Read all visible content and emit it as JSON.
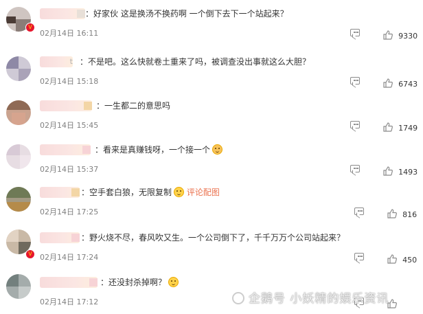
{
  "comments": [
    {
      "text": "：好家伙 这是换汤不换药啊 一个倒下去下一个站起来？",
      "time": "02月14日 16:11",
      "likes": "9330",
      "verified": true,
      "name_tail": "g"
    },
    {
      "text": "：不是吧。这么快就卷土重来了吗，被调查没出事就这么大胆？",
      "time": "02月14日 15:18",
      "likes": "6743",
      "verified": false,
      "name_tail": "t"
    },
    {
      "text": "：一生都二的意思吗",
      "time": "02月14日 15:45",
      "likes": "1749",
      "verified": false,
      "name_tail": "y"
    },
    {
      "text": "：看来是真赚钱呀，一个接一个",
      "time": "02月14日 15:37",
      "likes": "1493",
      "verified": false,
      "name_tail": "p"
    },
    {
      "text": "：空手套白狼，无限复制",
      "link": "评论配图",
      "time": "02月14日 17:25",
      "likes": "816",
      "verified": false,
      "name_tail": "y"
    },
    {
      "text": "：野火烧不尽，春风吹又生。一个公司倒下了，千千万万个公司站起来？",
      "time": "02月14日 17:24",
      "likes": "450",
      "verified": true,
      "name_tail": "p"
    },
    {
      "text": "：还没封杀掉啊？",
      "time": "02月14日 17:12",
      "likes": "",
      "verified": false,
      "name_tail": "p"
    }
  ],
  "watermark": "企鹅号 小妖精的娱乐资讯",
  "colors": {
    "link": "#eb7350",
    "time": "#808080",
    "icon": "#8a8a8a",
    "verified_badge": "#e6162d"
  },
  "icons": {
    "reply": "comment-bubble-icon",
    "like": "thumbs-up-icon",
    "verified": "verified-v-icon",
    "emoji": "smiley-emoji-icon"
  }
}
